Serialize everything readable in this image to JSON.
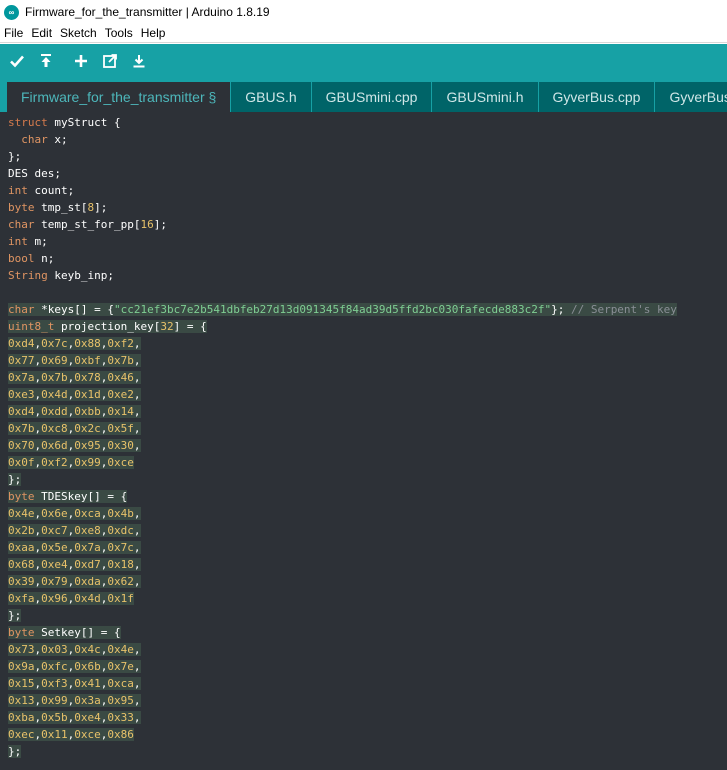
{
  "window": {
    "title": "Firmware_for_the_transmitter | Arduino 1.8.19"
  },
  "menu": [
    "File",
    "Edit",
    "Sketch",
    "Tools",
    "Help"
  ],
  "toolbar": [
    "verify-icon",
    "upload-icon",
    "new-icon",
    "open-icon",
    "save-icon"
  ],
  "tabs": [
    {
      "label": "Firmware_for_the_transmitter §",
      "active": true
    },
    {
      "label": "GBUS.h",
      "active": false
    },
    {
      "label": "GBUSmini.cpp",
      "active": false
    },
    {
      "label": "GBUSmini.h",
      "active": false
    },
    {
      "label": "GyverBus.cpp",
      "active": false
    },
    {
      "label": "GyverBus.h",
      "active": false
    }
  ],
  "colors": {
    "accent": "#17a1a5",
    "editor_bg": "#2d3137",
    "keyword": "#d67b4d",
    "number": "#e8c26a",
    "string": "#7fcf93",
    "comment": "#8a8f96"
  },
  "code_lines": [
    [
      [
        "kw",
        "struct"
      ],
      [
        "pl",
        " myStruct {"
      ]
    ],
    [
      [
        "pl",
        "  "
      ],
      [
        "ty",
        "char"
      ],
      [
        "pl",
        " x;"
      ]
    ],
    [
      [
        "pl",
        "};"
      ]
    ],
    [
      [
        "pl",
        "DES des;"
      ]
    ],
    [
      [
        "ty",
        "int"
      ],
      [
        "pl",
        " count;"
      ]
    ],
    [
      [
        "ty",
        "byte"
      ],
      [
        "pl",
        " tmp_st["
      ],
      [
        "num",
        "8"
      ],
      [
        "pl",
        "];"
      ]
    ],
    [
      [
        "ty",
        "char"
      ],
      [
        "pl",
        " temp_st_for_pp["
      ],
      [
        "num",
        "16"
      ],
      [
        "pl",
        "];"
      ]
    ],
    [
      [
        "ty",
        "int"
      ],
      [
        "pl",
        " m;"
      ]
    ],
    [
      [
        "ty",
        "bool"
      ],
      [
        "pl",
        " n;"
      ]
    ],
    [
      [
        "ty",
        "String"
      ],
      [
        "pl",
        " keyb_inp;"
      ]
    ],
    [],
    {
      "hl": true,
      "t": [
        [
          "ty",
          "char"
        ],
        [
          "pl",
          " *keys[] = {"
        ],
        [
          "str",
          "\"cc21ef3bc7e2b541dbfeb27d13d091345f84ad39d5ffd2bc030fafecde883c2f\""
        ],
        [
          "pl",
          "}; "
        ],
        [
          "cm",
          "// Serpent's key"
        ]
      ]
    },
    {
      "hl": true,
      "t": [
        [
          "ty",
          "uint8_t"
        ],
        [
          "pl",
          " projection_key["
        ],
        [
          "num",
          "32"
        ],
        [
          "pl",
          "] = {"
        ]
      ]
    },
    {
      "hl": true,
      "t": [
        [
          "num",
          "0xd4"
        ],
        [
          "pl",
          ","
        ],
        [
          "num",
          "0x7c"
        ],
        [
          "pl",
          ","
        ],
        [
          "num",
          "0x88"
        ],
        [
          "pl",
          ","
        ],
        [
          "num",
          "0xf2"
        ],
        [
          "pl",
          ","
        ]
      ]
    },
    {
      "hl": true,
      "t": [
        [
          "num",
          "0x77"
        ],
        [
          "pl",
          ","
        ],
        [
          "num",
          "0x69"
        ],
        [
          "pl",
          ","
        ],
        [
          "num",
          "0xbf"
        ],
        [
          "pl",
          ","
        ],
        [
          "num",
          "0x7b"
        ],
        [
          "pl",
          ","
        ]
      ]
    },
    {
      "hl": true,
      "t": [
        [
          "num",
          "0x7a"
        ],
        [
          "pl",
          ","
        ],
        [
          "num",
          "0x7b"
        ],
        [
          "pl",
          ","
        ],
        [
          "num",
          "0x78"
        ],
        [
          "pl",
          ","
        ],
        [
          "num",
          "0x46"
        ],
        [
          "pl",
          ","
        ]
      ]
    },
    {
      "hl": true,
      "t": [
        [
          "num",
          "0xe3"
        ],
        [
          "pl",
          ","
        ],
        [
          "num",
          "0x4d"
        ],
        [
          "pl",
          ","
        ],
        [
          "num",
          "0x1d"
        ],
        [
          "pl",
          ","
        ],
        [
          "num",
          "0xe2"
        ],
        [
          "pl",
          ","
        ]
      ]
    },
    {
      "hl": true,
      "t": [
        [
          "num",
          "0xd4"
        ],
        [
          "pl",
          ","
        ],
        [
          "num",
          "0xdd"
        ],
        [
          "pl",
          ","
        ],
        [
          "num",
          "0xbb"
        ],
        [
          "pl",
          ","
        ],
        [
          "num",
          "0x14"
        ],
        [
          "pl",
          ","
        ]
      ]
    },
    {
      "hl": true,
      "t": [
        [
          "num",
          "0x7b"
        ],
        [
          "pl",
          ","
        ],
        [
          "num",
          "0xc8"
        ],
        [
          "pl",
          ","
        ],
        [
          "num",
          "0x2c"
        ],
        [
          "pl",
          ","
        ],
        [
          "num",
          "0x5f"
        ],
        [
          "pl",
          ","
        ]
      ]
    },
    {
      "hl": true,
      "t": [
        [
          "num",
          "0x70"
        ],
        [
          "pl",
          ","
        ],
        [
          "num",
          "0x6d"
        ],
        [
          "pl",
          ","
        ],
        [
          "num",
          "0x95"
        ],
        [
          "pl",
          ","
        ],
        [
          "num",
          "0x30"
        ],
        [
          "pl",
          ","
        ]
      ]
    },
    {
      "hl": true,
      "t": [
        [
          "num",
          "0x0f"
        ],
        [
          "pl",
          ","
        ],
        [
          "num",
          "0xf2"
        ],
        [
          "pl",
          ","
        ],
        [
          "num",
          "0x99"
        ],
        [
          "pl",
          ","
        ],
        [
          "num",
          "0xce"
        ]
      ]
    },
    {
      "hl": true,
      "t": [
        [
          "pl",
          "};"
        ]
      ]
    },
    {
      "hl": true,
      "t": [
        [
          "ty",
          "byte"
        ],
        [
          "pl",
          " TDESkey[] = {"
        ]
      ]
    },
    {
      "hl": true,
      "t": [
        [
          "num",
          "0x4e"
        ],
        [
          "pl",
          ","
        ],
        [
          "num",
          "0x6e"
        ],
        [
          "pl",
          ","
        ],
        [
          "num",
          "0xca"
        ],
        [
          "pl",
          ","
        ],
        [
          "num",
          "0x4b"
        ],
        [
          "pl",
          ","
        ]
      ]
    },
    {
      "hl": true,
      "t": [
        [
          "num",
          "0x2b"
        ],
        [
          "pl",
          ","
        ],
        [
          "num",
          "0xc7"
        ],
        [
          "pl",
          ","
        ],
        [
          "num",
          "0xe8"
        ],
        [
          "pl",
          ","
        ],
        [
          "num",
          "0xdc"
        ],
        [
          "pl",
          ","
        ]
      ]
    },
    {
      "hl": true,
      "t": [
        [
          "num",
          "0xaa"
        ],
        [
          "pl",
          ","
        ],
        [
          "num",
          "0x5e"
        ],
        [
          "pl",
          ","
        ],
        [
          "num",
          "0x7a"
        ],
        [
          "pl",
          ","
        ],
        [
          "num",
          "0x7c"
        ],
        [
          "pl",
          ","
        ]
      ]
    },
    {
      "hl": true,
      "t": [
        [
          "num",
          "0x68"
        ],
        [
          "pl",
          ","
        ],
        [
          "num",
          "0xe4"
        ],
        [
          "pl",
          ","
        ],
        [
          "num",
          "0xd7"
        ],
        [
          "pl",
          ","
        ],
        [
          "num",
          "0x18"
        ],
        [
          "pl",
          ","
        ]
      ]
    },
    {
      "hl": true,
      "t": [
        [
          "num",
          "0x39"
        ],
        [
          "pl",
          ","
        ],
        [
          "num",
          "0x79"
        ],
        [
          "pl",
          ","
        ],
        [
          "num",
          "0xda"
        ],
        [
          "pl",
          ","
        ],
        [
          "num",
          "0x62"
        ],
        [
          "pl",
          ","
        ]
      ]
    },
    {
      "hl": true,
      "t": [
        [
          "num",
          "0xfa"
        ],
        [
          "pl",
          ","
        ],
        [
          "num",
          "0x96"
        ],
        [
          "pl",
          ","
        ],
        [
          "num",
          "0x4d"
        ],
        [
          "pl",
          ","
        ],
        [
          "num",
          "0x1f"
        ]
      ]
    },
    {
      "hl": true,
      "t": [
        [
          "pl",
          "};"
        ]
      ]
    },
    {
      "hl": true,
      "t": [
        [
          "ty",
          "byte"
        ],
        [
          "pl",
          " Setkey[] = {"
        ]
      ]
    },
    {
      "hl": true,
      "t": [
        [
          "num",
          "0x73"
        ],
        [
          "pl",
          ","
        ],
        [
          "num",
          "0x03"
        ],
        [
          "pl",
          ","
        ],
        [
          "num",
          "0x4c"
        ],
        [
          "pl",
          ","
        ],
        [
          "num",
          "0x4e"
        ],
        [
          "pl",
          ","
        ]
      ]
    },
    {
      "hl": true,
      "t": [
        [
          "num",
          "0x9a"
        ],
        [
          "pl",
          ","
        ],
        [
          "num",
          "0xfc"
        ],
        [
          "pl",
          ","
        ],
        [
          "num",
          "0x6b"
        ],
        [
          "pl",
          ","
        ],
        [
          "num",
          "0x7e"
        ],
        [
          "pl",
          ","
        ]
      ]
    },
    {
      "hl": true,
      "t": [
        [
          "num",
          "0x15"
        ],
        [
          "pl",
          ","
        ],
        [
          "num",
          "0xf3"
        ],
        [
          "pl",
          ","
        ],
        [
          "num",
          "0x41"
        ],
        [
          "pl",
          ","
        ],
        [
          "num",
          "0xca"
        ],
        [
          "pl",
          ","
        ]
      ]
    },
    {
      "hl": true,
      "t": [
        [
          "num",
          "0x13"
        ],
        [
          "pl",
          ","
        ],
        [
          "num",
          "0x99"
        ],
        [
          "pl",
          ","
        ],
        [
          "num",
          "0x3a"
        ],
        [
          "pl",
          ","
        ],
        [
          "num",
          "0x95"
        ],
        [
          "pl",
          ","
        ]
      ]
    },
    {
      "hl": true,
      "t": [
        [
          "num",
          "0xba"
        ],
        [
          "pl",
          ","
        ],
        [
          "num",
          "0x5b"
        ],
        [
          "pl",
          ","
        ],
        [
          "num",
          "0xe4"
        ],
        [
          "pl",
          ","
        ],
        [
          "num",
          "0x33"
        ],
        [
          "pl",
          ","
        ]
      ]
    },
    {
      "hl": true,
      "t": [
        [
          "num",
          "0xec"
        ],
        [
          "pl",
          ","
        ],
        [
          "num",
          "0x11"
        ],
        [
          "pl",
          ","
        ],
        [
          "num",
          "0xce"
        ],
        [
          "pl",
          ","
        ],
        [
          "num",
          "0x86"
        ]
      ]
    },
    {
      "hl": true,
      "t": [
        [
          "pl",
          "};"
        ]
      ]
    }
  ]
}
